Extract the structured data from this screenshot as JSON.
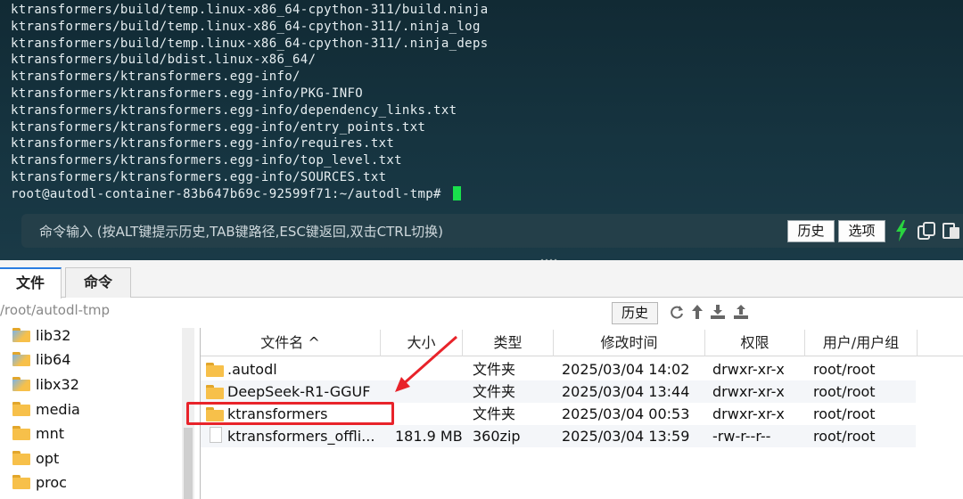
{
  "terminal": {
    "lines": [
      "ktransformers/build/temp.linux-x86_64-cpython-311/build.ninja",
      "ktransformers/build/temp.linux-x86_64-cpython-311/.ninja_log",
      "ktransformers/build/temp.linux-x86_64-cpython-311/.ninja_deps",
      "ktransformers/build/bdist.linux-x86_64/",
      "ktransformers/ktransformers.egg-info/",
      "ktransformers/ktransformers.egg-info/PKG-INFO",
      "ktransformers/ktransformers.egg-info/dependency_links.txt",
      "ktransformers/ktransformers.egg-info/entry_points.txt",
      "ktransformers/ktransformers.egg-info/requires.txt",
      "ktransformers/ktransformers.egg-info/top_level.txt",
      "ktransformers/ktransformers.egg-info/SOURCES.txt"
    ],
    "prompt": "root@autodl-container-83b647b69c-92599f71:~/autodl-tmp# ",
    "command_bar": {
      "placeholder": "命令输入 (按ALT键提示历史,TAB键路径,ESC键返回,双击CTRL切换)",
      "history_label": "历史",
      "options_label": "选项"
    },
    "cursor_color": "#19e04c"
  },
  "file_manager": {
    "tabs": [
      {
        "label": "文件",
        "active": true
      },
      {
        "label": "命令",
        "active": false
      }
    ],
    "path": "/root/autodl-tmp",
    "history_label": "历史",
    "toolbar_icons": [
      "refresh-icon",
      "up-icon",
      "download-icon",
      "upload-icon"
    ],
    "tree": [
      {
        "label": "lib32",
        "icon": "folder-link-icon"
      },
      {
        "label": "lib64",
        "icon": "folder-link-icon"
      },
      {
        "label": "libx32",
        "icon": "folder-link-icon"
      },
      {
        "label": "media",
        "icon": "folder-icon"
      },
      {
        "label": "mnt",
        "icon": "folder-icon"
      },
      {
        "label": "opt",
        "icon": "folder-icon"
      },
      {
        "label": "proc",
        "icon": "folder-icon"
      }
    ],
    "columns": [
      "文件名 ^",
      "大小",
      "类型",
      "修改时间",
      "权限",
      "用户/用户组"
    ],
    "files": [
      {
        "name": ".autodl",
        "size": "",
        "type": "文件夹",
        "modified": "2025/03/04 14:02",
        "perm": "drwxr-xr-x",
        "owner": "root/root",
        "icon": "folder-icon"
      },
      {
        "name": "DeepSeek-R1-GGUF",
        "size": "",
        "type": "文件夹",
        "modified": "2025/03/04 13:44",
        "perm": "drwxr-xr-x",
        "owner": "root/root",
        "icon": "folder-icon"
      },
      {
        "name": "ktransformers",
        "size": "",
        "type": "文件夹",
        "modified": "2025/03/04 00:53",
        "perm": "drwxr-xr-x",
        "owner": "root/root",
        "icon": "folder-icon"
      },
      {
        "name": "ktransformers_offli...",
        "size": "181.9 MB",
        "type": "360zip",
        "modified": "2025/03/04 13:59",
        "perm": "-rw-r--r--",
        "owner": "root/root",
        "icon": "zip-file-icon"
      }
    ],
    "highlight_color": "#e8232a"
  }
}
